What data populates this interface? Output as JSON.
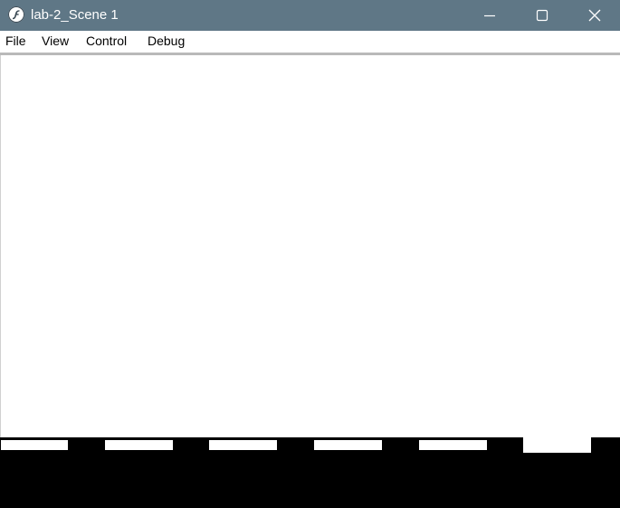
{
  "window": {
    "title": "lab-2_Scene 1",
    "app_icon": "flash-player-icon"
  },
  "controls": {
    "minimize_icon": "minimize-icon",
    "maximize_icon": "maximize-icon",
    "close_icon": "close-icon"
  },
  "menu": {
    "items": [
      {
        "label": "File"
      },
      {
        "label": "View"
      },
      {
        "label": "Control"
      },
      {
        "label": "Debug"
      }
    ]
  },
  "colors": {
    "titlebar": "#5f7786",
    "stage": "#ffffff",
    "ground": "#000000"
  }
}
